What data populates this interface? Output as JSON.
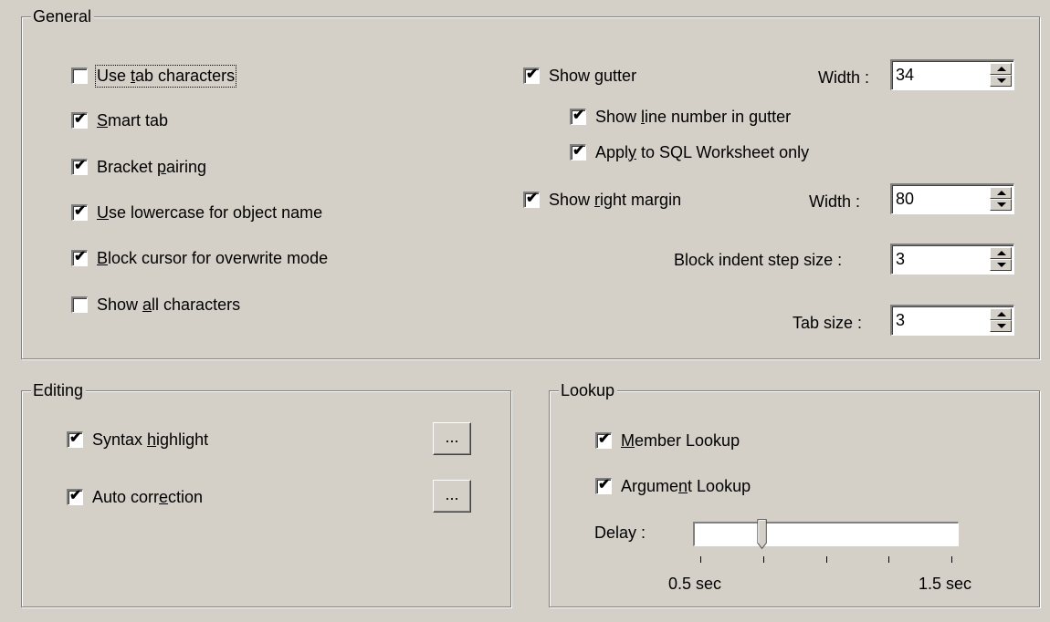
{
  "general": {
    "title": "General",
    "left_options": [
      {
        "pre": "Use ",
        "ul": "t",
        "post": "ab characters",
        "checked": false
      },
      {
        "pre": "",
        "ul": "S",
        "post": "mart tab",
        "checked": true
      },
      {
        "pre": "Bracket ",
        "ul": "p",
        "post": "airing",
        "checked": true
      },
      {
        "pre": "",
        "ul": "U",
        "post": "se lowercase for object name",
        "checked": true
      },
      {
        "pre": "",
        "ul": "B",
        "post": "lock cursor for overwrite mode",
        "checked": true
      },
      {
        "pre": "Show ",
        "ul": "a",
        "post": "ll characters",
        "checked": false
      }
    ],
    "show_gutter": {
      "pre": "Show ",
      "ul": "g",
      "post": "utter",
      "checked": true
    },
    "show_line_number": {
      "pre": "Show ",
      "ul": "l",
      "post": "ine number in gutter",
      "checked": true
    },
    "apply_sql": {
      "pre": "Appl",
      "ul": "y",
      "post": " to SQL Worksheet only",
      "checked": true
    },
    "show_right_margin": {
      "pre": "Show ",
      "ul": "r",
      "post": "ight margin",
      "checked": true
    },
    "gutter_width_label": "Width :",
    "gutter_width_value": "34",
    "margin_width_label": "Width :",
    "margin_width_value": "80",
    "block_indent_label": "Block indent step size :",
    "block_indent_value": "3",
    "tab_size_label": "Tab size :",
    "tab_size_value": "3"
  },
  "editing": {
    "title": "Editing",
    "syntax": {
      "pre": "Syntax ",
      "ul": "h",
      "post": "ighlight",
      "checked": true
    },
    "auto": {
      "pre": "Auto corr",
      "ul": "e",
      "post": "ction",
      "checked": true
    },
    "ellipsis_label": "..."
  },
  "lookup": {
    "title": "Lookup",
    "member": {
      "pre": "",
      "ul": "M",
      "post": "ember Lookup",
      "checked": true
    },
    "argument": {
      "pre": "Argume",
      "ul": "n",
      "post": "t Lookup",
      "checked": true
    },
    "delay_label": "Delay :",
    "min_label": "0.5 sec",
    "max_label": "1.5 sec",
    "delay_position": 0.25
  }
}
